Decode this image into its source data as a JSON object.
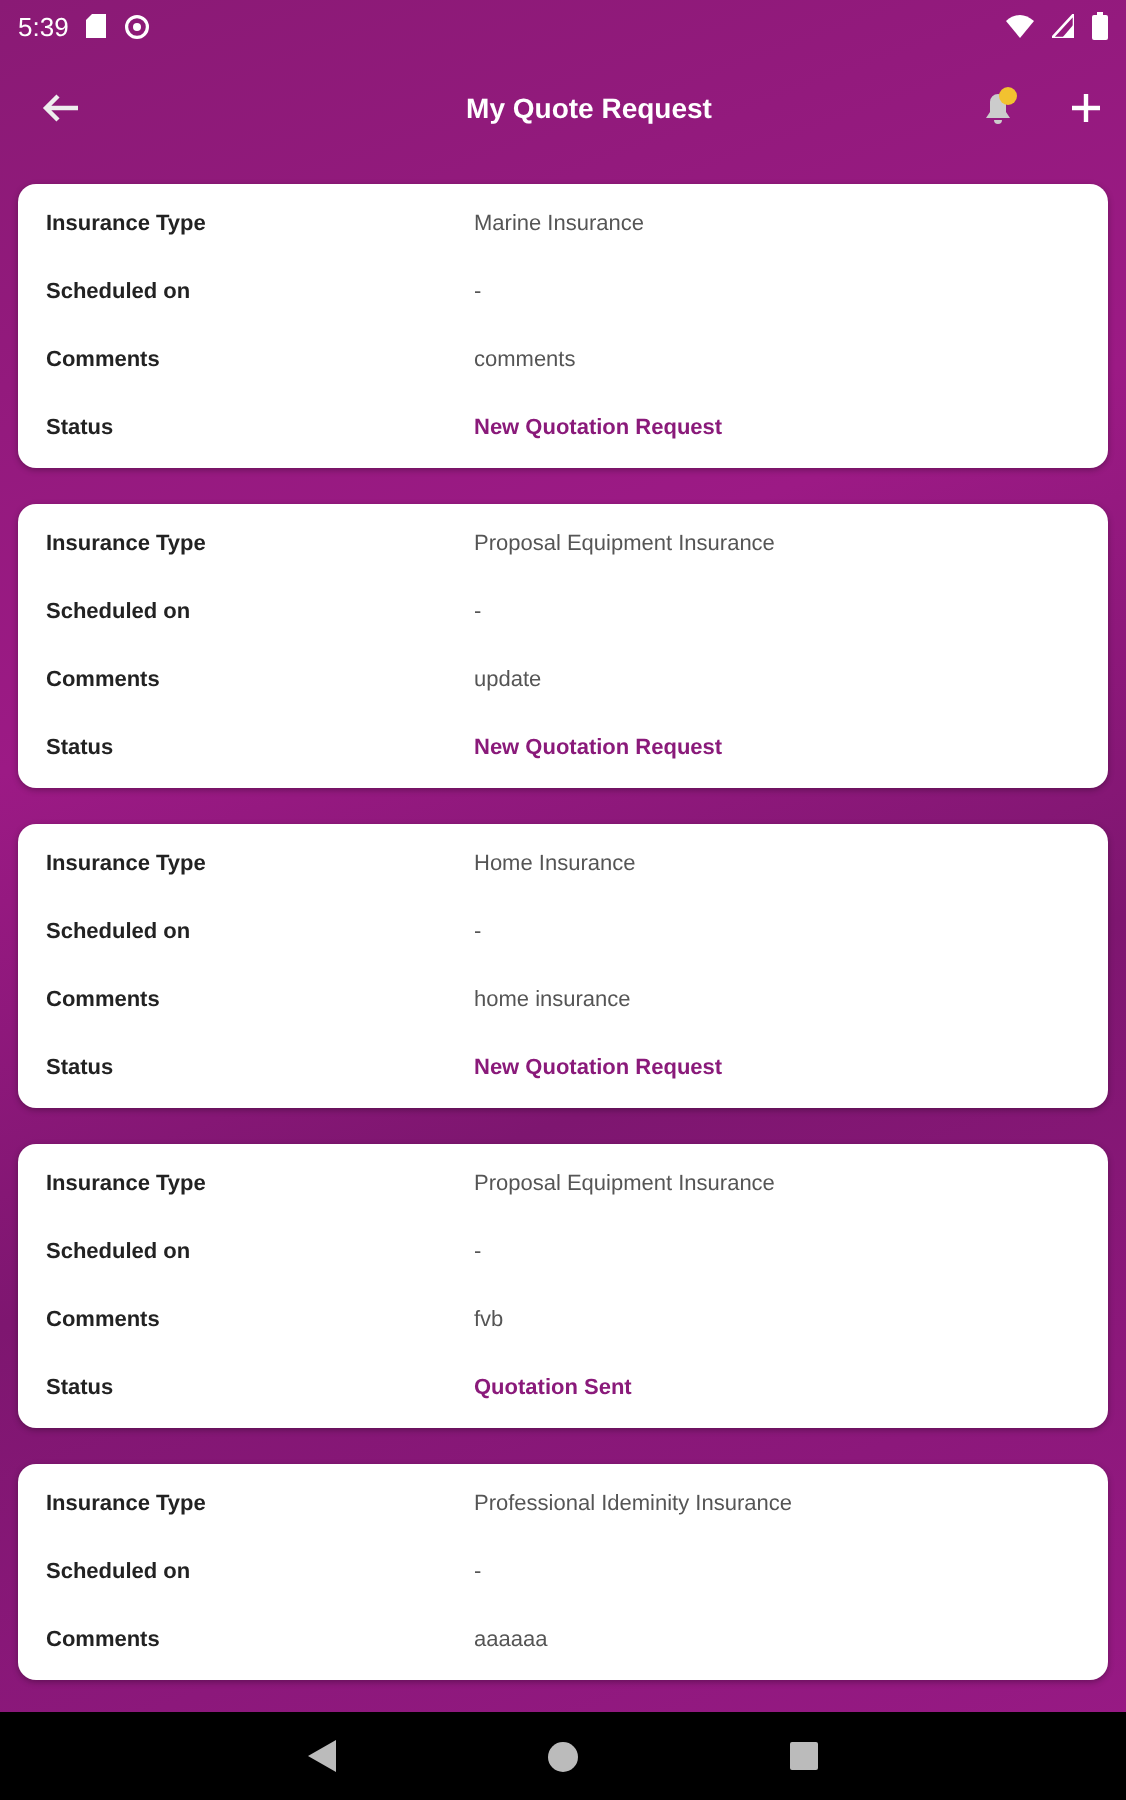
{
  "status_bar": {
    "time": "5:39"
  },
  "app_bar": {
    "title": "My Quote Request"
  },
  "requests": [
    {
      "fields": [
        {
          "label": "Insurance Type",
          "value": "Marine Insurance",
          "kind": "text"
        },
        {
          "label": "Scheduled on",
          "value": "-",
          "kind": "text"
        },
        {
          "label": "Comments",
          "value": "comments",
          "kind": "text"
        },
        {
          "label": "Status",
          "value": "New Quotation Request",
          "kind": "status"
        }
      ]
    },
    {
      "fields": [
        {
          "label": "Insurance Type",
          "value": "Proposal Equipment Insurance",
          "kind": "text"
        },
        {
          "label": "Scheduled on",
          "value": "-",
          "kind": "text"
        },
        {
          "label": "Comments",
          "value": "update",
          "kind": "text"
        },
        {
          "label": "Status",
          "value": "New Quotation Request",
          "kind": "status"
        }
      ]
    },
    {
      "fields": [
        {
          "label": "Insurance Type",
          "value": "Home Insurance",
          "kind": "text"
        },
        {
          "label": "Scheduled on",
          "value": "-",
          "kind": "text"
        },
        {
          "label": "Comments",
          "value": "home insurance",
          "kind": "text"
        },
        {
          "label": "Status",
          "value": "New Quotation Request",
          "kind": "status"
        }
      ]
    },
    {
      "fields": [
        {
          "label": "Insurance Type",
          "value": "Proposal Equipment Insurance",
          "kind": "text"
        },
        {
          "label": "Scheduled on",
          "value": "-",
          "kind": "text"
        },
        {
          "label": "Comments",
          "value": "fvb",
          "kind": "text"
        },
        {
          "label": "Status",
          "value": "Quotation Sent",
          "kind": "status"
        }
      ]
    },
    {
      "fields": [
        {
          "label": "Insurance Type",
          "value": "Professional Ideminity Insurance",
          "kind": "text"
        },
        {
          "label": "Scheduled on",
          "value": "-",
          "kind": "text"
        },
        {
          "label": "Comments",
          "value": "aaaaaa",
          "kind": "text"
        }
      ]
    }
  ]
}
